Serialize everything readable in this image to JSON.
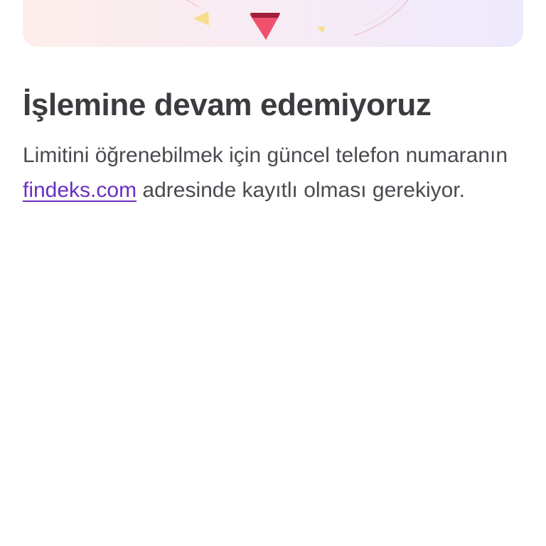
{
  "illustration": {
    "shapes": [
      "yellow-triangle-icon",
      "red-triangle-icon",
      "small-yellow-triangle-icon"
    ]
  },
  "error": {
    "title": "İşlemine devam edemiyoruz",
    "message_before_link": "Limitini öğrenebilmek için güncel telefon numaranın ",
    "link_text": "findeks.com",
    "message_after_link": " adresinde kayıtlı olması gerekiyor."
  },
  "colors": {
    "title": "#3b3b40",
    "body": "#4a4a50",
    "link": "#6a2fc2",
    "accent_red": "#f0506e",
    "accent_yellow": "#f5dd8a"
  }
}
